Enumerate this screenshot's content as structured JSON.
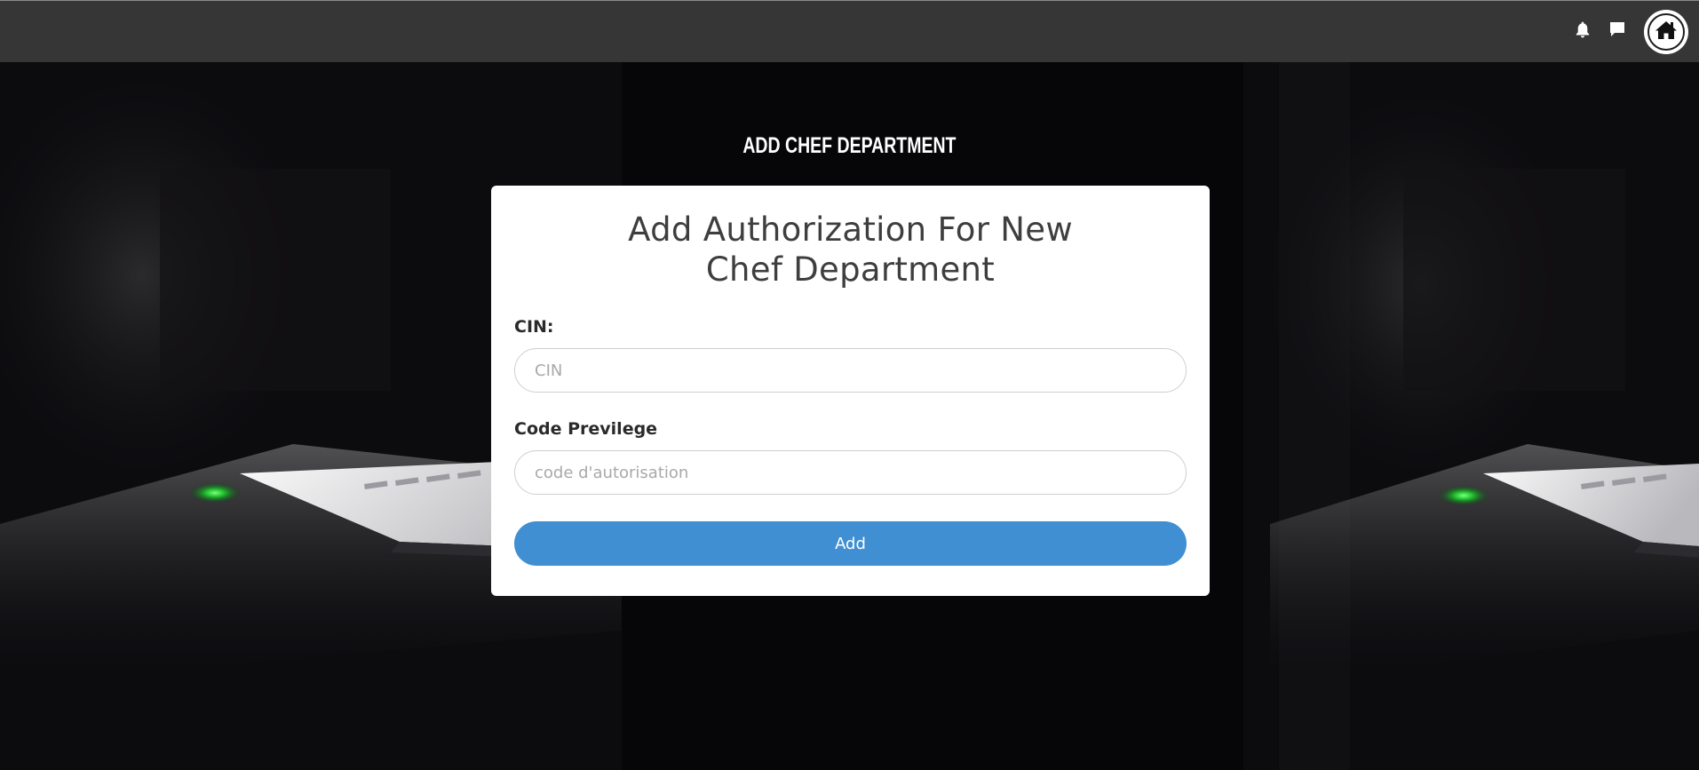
{
  "topbar": {
    "icons": [
      "bell-icon",
      "chat-icon",
      "home-icon"
    ],
    "background": "#363636"
  },
  "page": {
    "heading": "ADD CHEF DEPARTMENT"
  },
  "form": {
    "title": "Add Authorization For New Chef Department",
    "cin_label": "CIN:",
    "cin_placeholder": "CIN",
    "cin_value": "",
    "code_label": "Code Previlege",
    "code_placeholder": "code d'autorisation",
    "code_value": "",
    "submit_label": "Add"
  },
  "colors": {
    "accent": "#3f8fd2",
    "card": "#ffffff",
    "topbar": "#363636"
  }
}
